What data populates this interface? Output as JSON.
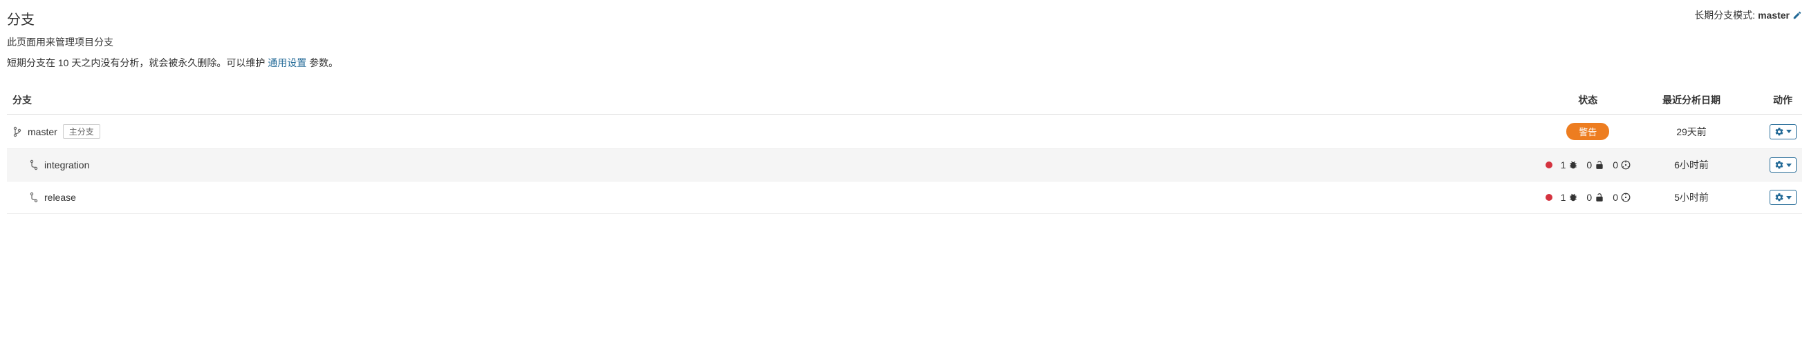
{
  "header": {
    "title": "分支",
    "long_term_label": "长期分支模式:",
    "long_term_value": "master"
  },
  "subtitle": "此页面用来管理项目分支",
  "description": {
    "prefix": "短期分支在 10 天之内没有分析，就会被永久删除。可以维护 ",
    "link_text": "通用设置",
    "suffix": " 参数。"
  },
  "columns": {
    "branch": "分支",
    "status": "状态",
    "date": "最近分析日期",
    "action": "动作"
  },
  "main_badge": "主分支",
  "warn_label": "警告",
  "rows": [
    {
      "name": "master",
      "is_main": true,
      "status_type": "warn",
      "date": "29天前"
    },
    {
      "name": "integration",
      "is_main": false,
      "status_type": "counts",
      "bugs": 1,
      "vulnerabilities": 0,
      "smells": 0,
      "date": "6小时前"
    },
    {
      "name": "release",
      "is_main": false,
      "status_type": "counts",
      "bugs": 1,
      "vulnerabilities": 0,
      "smells": 0,
      "date": "5小时前"
    }
  ]
}
